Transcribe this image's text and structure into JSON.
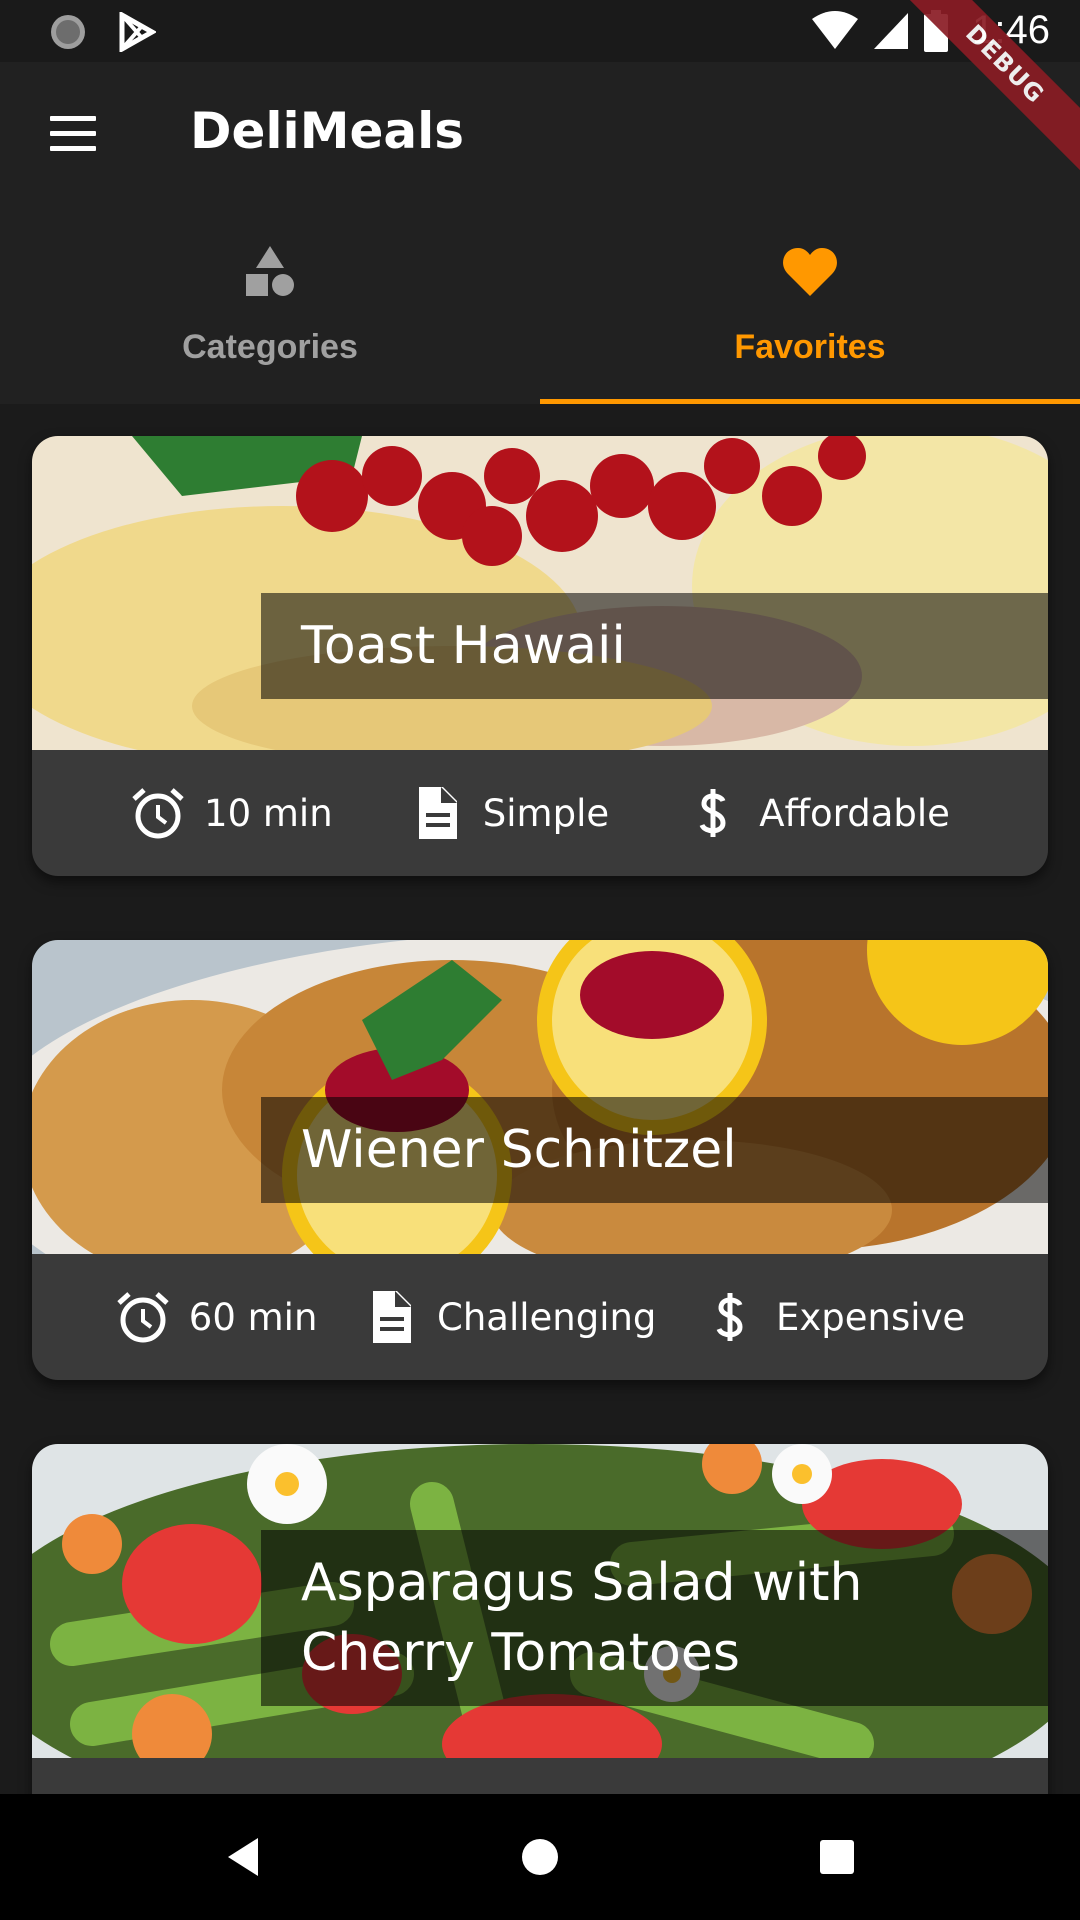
{
  "status_bar": {
    "time": "1:46",
    "icons": [
      "loading-indicator-icon",
      "play-store-icon",
      "wifi-icon",
      "cell-signal-icon",
      "battery-icon"
    ]
  },
  "debug_banner": "DEBUG",
  "app_bar": {
    "title": "DeliMeals",
    "menu_icon": "menu-icon"
  },
  "tabs": [
    {
      "label": "Categories",
      "icon": "category-icon",
      "active": false
    },
    {
      "label": "Favorites",
      "icon": "heart-icon",
      "active": true
    }
  ],
  "accent_color": "#ff9800",
  "meals": [
    {
      "title": "Toast Hawaii",
      "duration": "10 min",
      "complexity": "Simple",
      "affordability": "Affordable"
    },
    {
      "title": "Wiener Schnitzel",
      "duration": "60 min",
      "complexity": "Challenging",
      "affordability": "Expensive"
    },
    {
      "title": "Asparagus Salad with Cherry Tomatoes"
    }
  ],
  "info_icons": [
    "alarm-icon",
    "document-icon",
    "dollar-icon"
  ],
  "nav_bar": [
    "back-icon",
    "home-icon",
    "recents-icon"
  ]
}
